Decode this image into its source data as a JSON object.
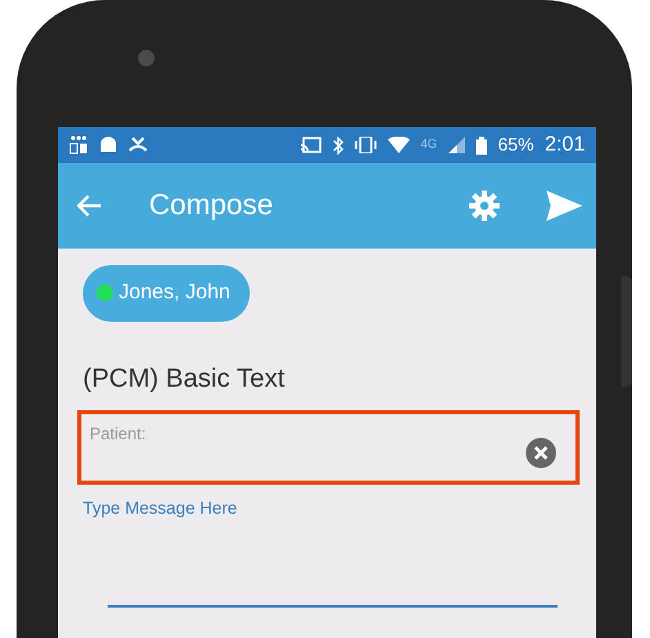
{
  "status_bar": {
    "network": "4G",
    "battery": "65%",
    "time": "2:01"
  },
  "app_bar": {
    "title": "Compose"
  },
  "recipients": [
    {
      "name": "Jones, John",
      "color": "#22dd55"
    }
  ],
  "template_title": "(PCM) Basic Text",
  "patient_field": {
    "label": "Patient:",
    "highlighted": true
  },
  "message_field": {
    "placeholder": "Type Message Here"
  }
}
